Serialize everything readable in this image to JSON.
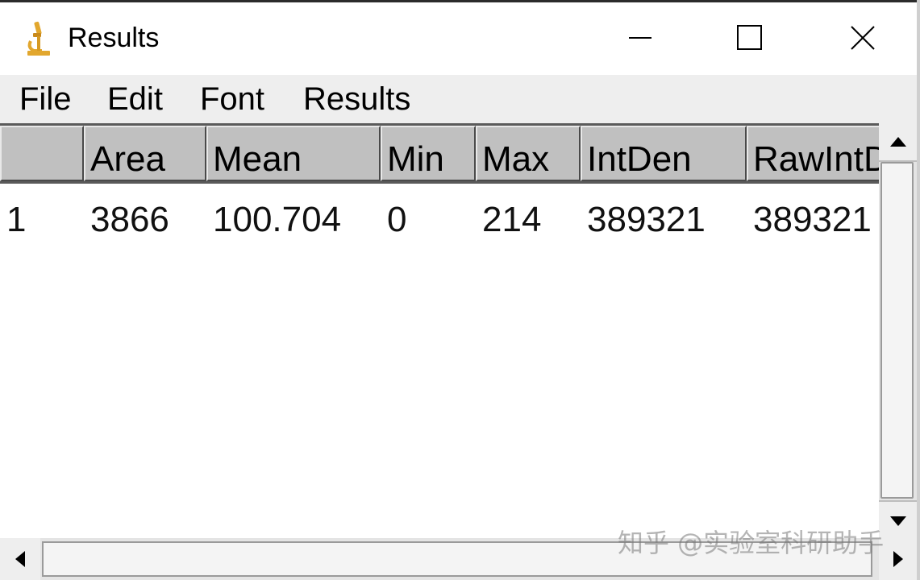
{
  "window": {
    "title": "Results",
    "controls": {
      "minimize": "minimize",
      "maximize": "maximize",
      "close": "close"
    }
  },
  "menu": {
    "items": [
      {
        "label": "File"
      },
      {
        "label": "Edit"
      },
      {
        "label": "Font"
      },
      {
        "label": "Results"
      }
    ]
  },
  "table": {
    "columns": [
      "",
      "Area",
      "Mean",
      "Min",
      "Max",
      "IntDen",
      "RawIntD"
    ],
    "rows": [
      [
        "1",
        "3866",
        "100.704",
        "0",
        "214",
        "389321",
        "389321"
      ]
    ]
  },
  "watermark": "知乎 @实验室科研助手",
  "colors": {
    "icon": "#e2a72e",
    "header_bg": "#c0c0c0"
  }
}
